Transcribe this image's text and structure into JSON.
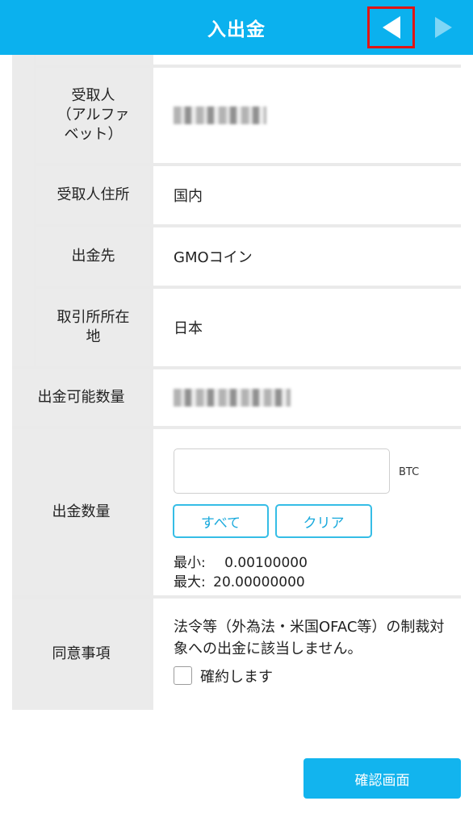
{
  "header": {
    "title": "入出金",
    "prev_icon": "triangle-left-icon",
    "next_icon": "triangle-right-icon"
  },
  "rows": {
    "recipient_alpha": {
      "label": "受取人\n（アルファ\nベット）"
    },
    "recipient_address": {
      "label": "受取人住所",
      "value": "国内"
    },
    "destination": {
      "label": "出金先",
      "value": "GMOコイン"
    },
    "exchange_location": {
      "label": "取引所所在\n地",
      "value": "日本"
    },
    "withdrawable": {
      "label": "出金可能数量"
    },
    "withdraw_amount": {
      "label": "出金数量",
      "input_value": "",
      "unit": "BTC",
      "all_button": "すべて",
      "clear_button": "クリア",
      "min_label": "最小:",
      "min_value": "0.00100000",
      "max_label": "最大:",
      "max_value": "20.00000000"
    },
    "consent": {
      "label": "同意事項",
      "text": "法令等（外為法・米国OFAC等）の制裁対象への出金に該当しません。",
      "checkbox_label": "確約します",
      "checked": false
    }
  },
  "confirm_button": "確認画面",
  "colors": {
    "header_bg": "#0bb1ee",
    "accent": "#35bde6",
    "highlight_border": "#e01515"
  }
}
